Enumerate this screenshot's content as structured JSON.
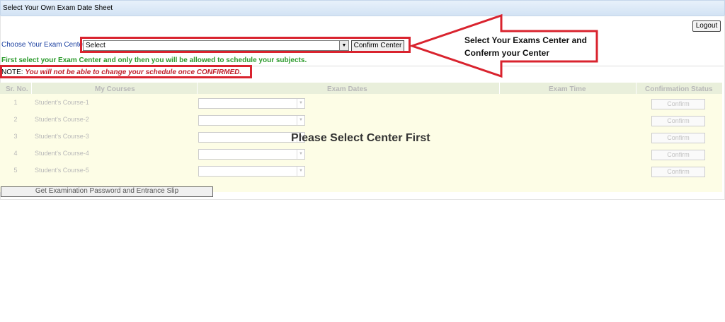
{
  "window": {
    "title": "Select Your Own Exam Date Sheet"
  },
  "header": {
    "logout_label": "Logout"
  },
  "center": {
    "label": "Choose Your Exam Center:",
    "select_value": "Select",
    "confirm_label": "Confirm Center",
    "info": "First select your Exam Center and only then you will be allowed to schedule your subjects.",
    "note_prefix": "NOTE:",
    "note_text": "You will not be able to change your schedule once CONFIRMED."
  },
  "table": {
    "headers": [
      "Sr. No.",
      "My Courses",
      "Exam Dates",
      "Exam Time",
      "Confirmation Status"
    ],
    "rows": [
      {
        "no": "1",
        "course": "Student's Course-1",
        "button": "Confirm"
      },
      {
        "no": "2",
        "course": "Student's Course-2",
        "button": "Confirm"
      },
      {
        "no": "3",
        "course": "Student's Course-3",
        "button": "Confirm"
      },
      {
        "no": "4",
        "course": "Student's Course-4",
        "button": "Confirm"
      },
      {
        "no": "5",
        "course": "Student's Course-5",
        "button": "Confirm"
      }
    ],
    "overlay": "Please Select Center First",
    "get_button": "Get Examination Password and Entrance Slip"
  },
  "annotation": {
    "line1": "Select Your Exams Center and",
    "line2": "Conferm your Center",
    "color": "#d9232e"
  }
}
